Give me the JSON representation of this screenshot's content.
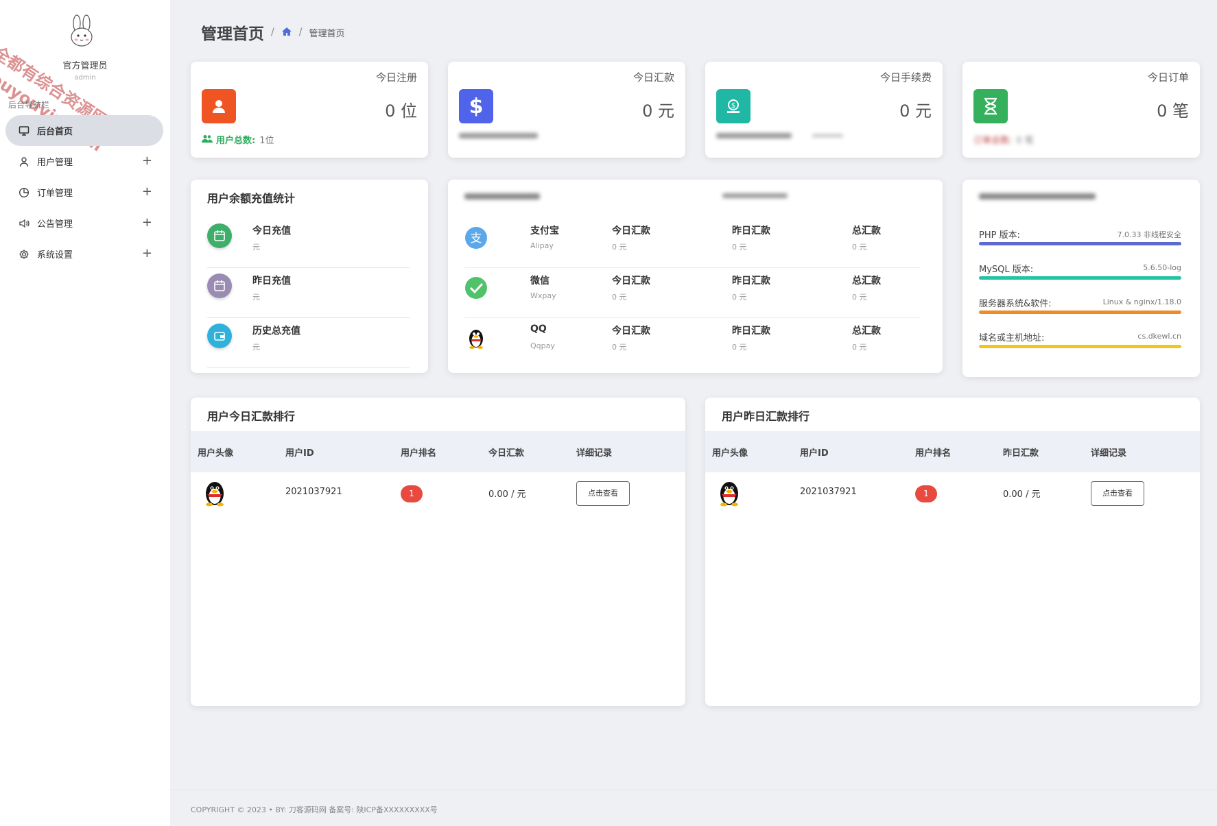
{
  "sidebar": {
    "admin_name": "官方管理员",
    "admin_role": "admin",
    "watermark_line1": "全都有综合资源网",
    "watermark_line2": "douyouvip.com",
    "nav_title": "后台导航栏",
    "items": [
      {
        "label": "后台首页",
        "icon": "monitor-icon",
        "active": true
      },
      {
        "label": "用户管理",
        "icon": "user-icon"
      },
      {
        "label": "订单管理",
        "icon": "pie-chart-icon"
      },
      {
        "label": "公告管理",
        "icon": "speaker-icon"
      },
      {
        "label": "系统设置",
        "icon": "gear-icon"
      }
    ]
  },
  "header": {
    "title": "管理首页",
    "breadcrumb_current": "管理首页"
  },
  "stats": [
    {
      "title": "今日注册",
      "value": "0 位",
      "color": "#ef5423",
      "icon": "user-icon",
      "footer_label": "用户总数:",
      "footer_value": "1位"
    },
    {
      "title": "今日汇款",
      "value": "0 元",
      "color": "#4f64ea",
      "icon": "dollar-icon"
    },
    {
      "title": "今日手续费",
      "value": "0 元",
      "color": "#20b8a4",
      "icon": "money-box-icon"
    },
    {
      "title": "今日订单",
      "value": "0 笔",
      "color": "#35b05c",
      "icon": "hourglass-icon",
      "footer_label": "订单总数:",
      "footer_value": "0 笔"
    }
  ],
  "recharge": {
    "title": "用户余额充值统计",
    "items": [
      {
        "label": "今日充值",
        "value": "元",
        "color": "#3fae6b",
        "icon": "calendar-icon"
      },
      {
        "label": "昨日充值",
        "value": "元",
        "color": "#9a8bb3",
        "icon": "calendar-icon"
      },
      {
        "label": "历史总充值",
        "value": "元",
        "color": "#2fb1dc",
        "icon": "wallet-icon"
      }
    ]
  },
  "payments": {
    "rows": [
      {
        "name": "支付宝",
        "sub": "Alipay",
        "icon": "alipay-icon",
        "today_label": "今日汇款",
        "today_value": "0 元",
        "yesterday_label": "昨日汇款",
        "yesterday_value": "0 元",
        "total_label": "总汇款",
        "total_value": "0 元"
      },
      {
        "name": "微信",
        "sub": "Wxpay",
        "icon": "wechat-icon",
        "today_label": "今日汇款",
        "today_value": "0 元",
        "yesterday_label": "昨日汇款",
        "yesterday_value": "0 元",
        "total_label": "总汇款",
        "total_value": "0 元"
      },
      {
        "name": "QQ",
        "sub": "Qqpay",
        "icon": "qq-penguin-icon",
        "today_label": "今日汇款",
        "today_value": "0 元",
        "yesterday_label": "昨日汇款",
        "yesterday_value": "0 元",
        "total_label": "总汇款",
        "total_value": "0 元"
      }
    ]
  },
  "server": {
    "items": [
      {
        "label": "PHP 版本:",
        "value": "7.0.33 非线程安全",
        "color": "#5d6ad2"
      },
      {
        "label": "MySQL 版本:",
        "value": "5.6.50-log",
        "color": "#24c3a5"
      },
      {
        "label": "服务器系统&软件:",
        "value": "Linux & nginx/1.18.0",
        "color": "#f08c24"
      },
      {
        "label": "域名或主机地址:",
        "value": "cs.dkewl.cn",
        "color": "#f2c518"
      }
    ]
  },
  "rank_today": {
    "title": "用户今日汇款排行",
    "headers": [
      "用户头像",
      "用户ID",
      "用户排名",
      "今日汇款",
      "详细记录"
    ],
    "rows": [
      {
        "id": "2021037921",
        "rank": "1",
        "amount": "0.00 / 元",
        "button": "点击查看"
      }
    ]
  },
  "rank_yesterday": {
    "title": "用户昨日汇款排行",
    "headers": [
      "用户头像",
      "用户ID",
      "用户排名",
      "昨日汇款",
      "详细记录"
    ],
    "rows": [
      {
        "id": "2021037921",
        "rank": "1",
        "amount": "0.00 / 元",
        "button": "点击查看"
      }
    ]
  },
  "footer": {
    "text": "COPYRIGHT © 2023 • BY: 刀客源码网  备案号: 陕ICP备XXXXXXXXX号"
  }
}
